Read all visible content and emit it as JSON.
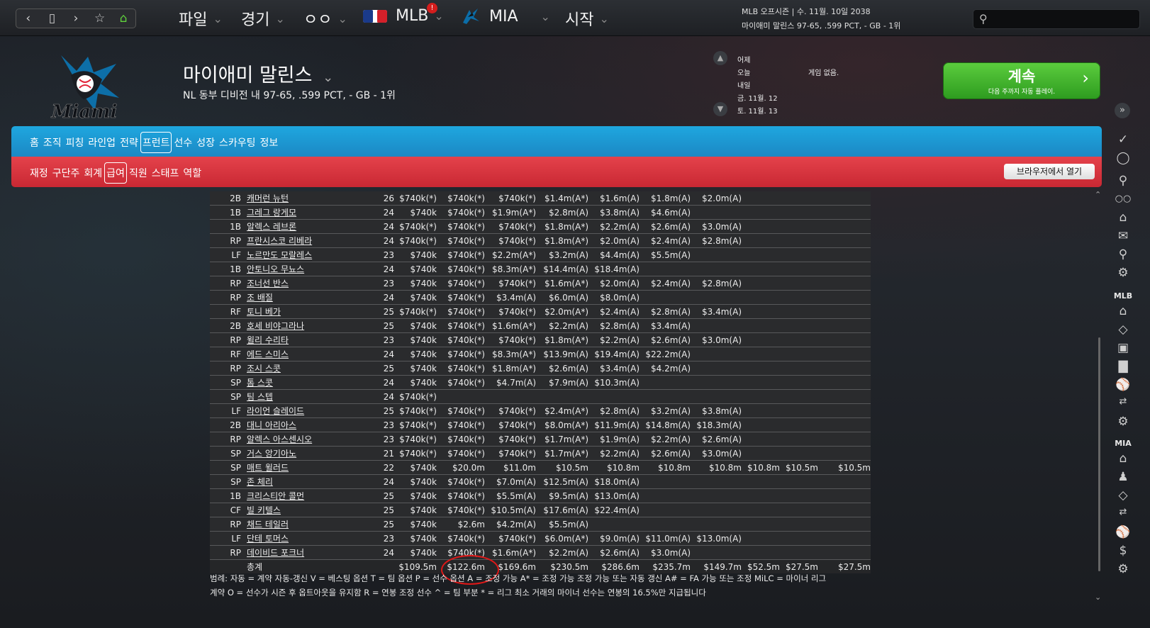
{
  "topbar": {
    "menus": [
      {
        "label": "파일"
      },
      {
        "label": "경기"
      },
      {
        "label": "ㅇㅇ"
      },
      {
        "label": "MLB",
        "badge": "!"
      },
      {
        "label": "MIA"
      },
      {
        "label": "시작"
      }
    ],
    "season_line1": "MLB 오프시즌 | 수. 11월. 10일 2038",
    "season_line2": "마이애미 말린스  97-65, .599 PCT, - GB - 1위",
    "search_placeholder": ""
  },
  "header": {
    "logo_text": "Miami",
    "team_name": "마이애미 말린스",
    "team_record": "NL 동부 디비전 내 97-65, .599 PCT, - GB - 1위",
    "schedule": [
      {
        "day": "어제",
        "info": ""
      },
      {
        "day": "오늘",
        "info": "게임 없음."
      },
      {
        "day": "내일",
        "info": ""
      },
      {
        "day": "금. 11월. 12",
        "info": ""
      },
      {
        "day": "토. 11월. 13",
        "info": ""
      }
    ],
    "continue_label": "계속",
    "continue_sub": "다음 주까지 자동 플레이."
  },
  "tabs_blue": [
    "홈",
    "조직",
    "피칭",
    "라인업",
    "전략",
    "프런트",
    "선수",
    "성장",
    "스카우팅",
    "정보"
  ],
  "tabs_blue_selected": "프런트",
  "tabs_red": [
    "재정",
    "구단주",
    "회계",
    "급여",
    "직원",
    "스태프",
    "역할"
  ],
  "tabs_red_selected": "급여",
  "open_browser_label": "브라우저에서 열기",
  "payroll": {
    "rows": [
      {
        "pos": "2B",
        "name": "캐머런 뉴턴",
        "age": "26",
        "vals": [
          "$740k(*)",
          "$740k(*)",
          "$740k(*)",
          "$1.4m(A*)",
          "$1.6m(A)",
          "$1.8m(A)",
          "$2.0m(A)",
          "",
          "",
          ""
        ]
      },
      {
        "pos": "1B",
        "name": "그레그 랑게모",
        "age": "24",
        "vals": [
          "$740k",
          "$740k(*)",
          "$1.9m(A*)",
          "$2.8m(A)",
          "$3.8m(A)",
          "$4.6m(A)",
          "",
          "",
          "",
          ""
        ]
      },
      {
        "pos": "1B",
        "name": "알렉스 레브론",
        "age": "24",
        "vals": [
          "$740k(*)",
          "$740k(*)",
          "$740k(*)",
          "$1.8m(A*)",
          "$2.2m(A)",
          "$2.6m(A)",
          "$3.0m(A)",
          "",
          "",
          ""
        ]
      },
      {
        "pos": "RP",
        "name": "프란시스코 리베라",
        "age": "24",
        "vals": [
          "$740k(*)",
          "$740k(*)",
          "$740k(*)",
          "$1.8m(A*)",
          "$2.0m(A)",
          "$2.4m(A)",
          "$2.8m(A)",
          "",
          "",
          ""
        ]
      },
      {
        "pos": "LF",
        "name": "노르만도 모랄레스",
        "age": "23",
        "vals": [
          "$740k",
          "$740k(*)",
          "$2.2m(A*)",
          "$3.2m(A)",
          "$4.4m(A)",
          "$5.5m(A)",
          "",
          "",
          "",
          ""
        ]
      },
      {
        "pos": "1B",
        "name": "안토니오 무뇨스",
        "age": "24",
        "vals": [
          "$740k",
          "$740k(*)",
          "$8.3m(A*)",
          "$14.4m(A)",
          "$18.4m(A)",
          "",
          "",
          "",
          "",
          ""
        ]
      },
      {
        "pos": "RP",
        "name": "조너선 반스",
        "age": "23",
        "vals": [
          "$740k",
          "$740k(*)",
          "$740k(*)",
          "$1.6m(A*)",
          "$2.0m(A)",
          "$2.4m(A)",
          "$2.8m(A)",
          "",
          "",
          ""
        ]
      },
      {
        "pos": "RP",
        "name": "조 배질",
        "age": "24",
        "vals": [
          "$740k",
          "$740k(*)",
          "$3.4m(A)",
          "$6.0m(A)",
          "$8.0m(A)",
          "",
          "",
          "",
          "",
          ""
        ]
      },
      {
        "pos": "RF",
        "name": "토니 베가",
        "age": "25",
        "vals": [
          "$740k(*)",
          "$740k(*)",
          "$740k(*)",
          "$2.0m(A*)",
          "$2.4m(A)",
          "$2.8m(A)",
          "$3.4m(A)",
          "",
          "",
          ""
        ]
      },
      {
        "pos": "2B",
        "name": "호세 비야그라나",
        "age": "25",
        "vals": [
          "$740k",
          "$740k(*)",
          "$1.6m(A*)",
          "$2.2m(A)",
          "$2.8m(A)",
          "$3.4m(A)",
          "",
          "",
          "",
          ""
        ]
      },
      {
        "pos": "RP",
        "name": "윌리 수리타",
        "age": "23",
        "vals": [
          "$740k",
          "$740k(*)",
          "$740k(*)",
          "$1.8m(A*)",
          "$2.2m(A)",
          "$2.6m(A)",
          "$3.0m(A)",
          "",
          "",
          ""
        ]
      },
      {
        "pos": "RF",
        "name": "에드 스미스",
        "age": "24",
        "vals": [
          "$740k",
          "$740k(*)",
          "$8.3m(A*)",
          "$13.9m(A)",
          "$19.4m(A)",
          "$22.2m(A)",
          "",
          "",
          "",
          ""
        ]
      },
      {
        "pos": "RP",
        "name": "조시 스콧",
        "age": "25",
        "vals": [
          "$740k",
          "$740k(*)",
          "$1.8m(A*)",
          "$2.6m(A)",
          "$3.4m(A)",
          "$4.2m(A)",
          "",
          "",
          "",
          ""
        ]
      },
      {
        "pos": "SP",
        "name": "톰 스콧",
        "age": "24",
        "vals": [
          "$740k",
          "$740k(*)",
          "$4.7m(A)",
          "$7.9m(A)",
          "$10.3m(A)",
          "",
          "",
          "",
          "",
          ""
        ]
      },
      {
        "pos": "SP",
        "name": "팀 스텝",
        "age": "24",
        "vals": [
          "$740k(*)",
          "",
          "",
          "",
          "",
          "",
          "",
          "",
          "",
          ""
        ]
      },
      {
        "pos": "LF",
        "name": "라이언 슬레이드",
        "age": "25",
        "vals": [
          "$740k(*)",
          "$740k(*)",
          "$740k(*)",
          "$2.4m(A*)",
          "$2.8m(A)",
          "$3.2m(A)",
          "$3.8m(A)",
          "",
          "",
          ""
        ]
      },
      {
        "pos": "2B",
        "name": "대니 아리아스",
        "age": "23",
        "vals": [
          "$740k(*)",
          "$740k(*)",
          "$740k(*)",
          "$8.0m(A*)",
          "$11.9m(A)",
          "$14.8m(A)",
          "$18.3m(A)",
          "",
          "",
          ""
        ]
      },
      {
        "pos": "RP",
        "name": "알렉스 아스센시오",
        "age": "23",
        "vals": [
          "$740k(*)",
          "$740k(*)",
          "$740k(*)",
          "$1.7m(A*)",
          "$1.9m(A)",
          "$2.2m(A)",
          "$2.6m(A)",
          "",
          "",
          ""
        ]
      },
      {
        "pos": "SP",
        "name": "거스 앙기아노",
        "age": "21",
        "vals": [
          "$740k(*)",
          "$740k(*)",
          "$740k(*)",
          "$1.7m(A*)",
          "$2.2m(A)",
          "$2.6m(A)",
          "$3.0m(A)",
          "",
          "",
          ""
        ]
      },
      {
        "pos": "SP",
        "name": "매트 윌러드",
        "age": "22",
        "vals": [
          "$740k",
          "$20.0m",
          "$11.0m",
          "$10.5m",
          "$10.8m",
          "$10.8m",
          "$10.8m",
          "$10.8m",
          "$10.5m",
          "$10.5m"
        ]
      },
      {
        "pos": "SP",
        "name": "존 체리",
        "age": "24",
        "vals": [
          "$740k",
          "$740k(*)",
          "$7.0m(A)",
          "$12.5m(A)",
          "$18.0m(A)",
          "",
          "",
          "",
          "",
          ""
        ]
      },
      {
        "pos": "1B",
        "name": "크리스티안 콜먼",
        "age": "25",
        "vals": [
          "$740k",
          "$740k(*)",
          "$5.5m(A)",
          "$9.5m(A)",
          "$13.0m(A)",
          "",
          "",
          "",
          "",
          ""
        ]
      },
      {
        "pos": "CF",
        "name": "빌 키텔스",
        "age": "25",
        "vals": [
          "$740k",
          "$740k(*)",
          "$10.5m(A)",
          "$17.6m(A)",
          "$22.4m(A)",
          "",
          "",
          "",
          "",
          ""
        ]
      },
      {
        "pos": "RP",
        "name": "채드 테일러",
        "age": "25",
        "vals": [
          "$740k",
          "$2.6m",
          "$4.2m(A)",
          "$5.5m(A)",
          "",
          "",
          "",
          "",
          "",
          ""
        ]
      },
      {
        "pos": "LF",
        "name": "단테 토머스",
        "age": "23",
        "vals": [
          "$740k",
          "$740k(*)",
          "$740k(*)",
          "$6.0m(A*)",
          "$9.0m(A)",
          "$11.0m(A)",
          "$13.0m(A)",
          "",
          "",
          ""
        ]
      },
      {
        "pos": "RP",
        "name": "데이비드 포크너",
        "age": "24",
        "vals": [
          "$740k",
          "$740k(*)",
          "$1.6m(A*)",
          "$2.2m(A)",
          "$2.6m(A)",
          "$3.0m(A)",
          "",
          "",
          "",
          ""
        ]
      }
    ],
    "total_label": "총계",
    "totals": [
      "$109.5m",
      "$122.6m",
      "$169.6m",
      "$230.5m",
      "$286.6m",
      "$235.7m",
      "$149.7m",
      "$52.5m",
      "$27.5m",
      "$27.5m"
    ]
  },
  "legend_line1": "범례: 자동 = 계약 자동-갱신 V = 베스팅 옵션 T = 팀 옵션 P = 선수 옵션 A = 조정 가능 A* = 조정 가능 조정 가능 또는 자동 갱신 A# = FA 가능 또는 조정 MiLC = 마이너 리그",
  "legend_line2": "계약 O = 선수가 시즌 후 옵트아웃을 유지함 R = 연봉 조정 선수 ^ = 팀 부분 * = 리그 최소 거래의 마이너 선수는 연봉의 16.5%만 지급됩니다",
  "sidebar": {
    "mlb_label": "MLB",
    "mia_label": "MIA"
  },
  "colors": {
    "blue_bar": "#1c94d1",
    "red_bar": "#d4323c",
    "continue_green": "#3cb52a",
    "highlight_circle": "#e01818"
  }
}
